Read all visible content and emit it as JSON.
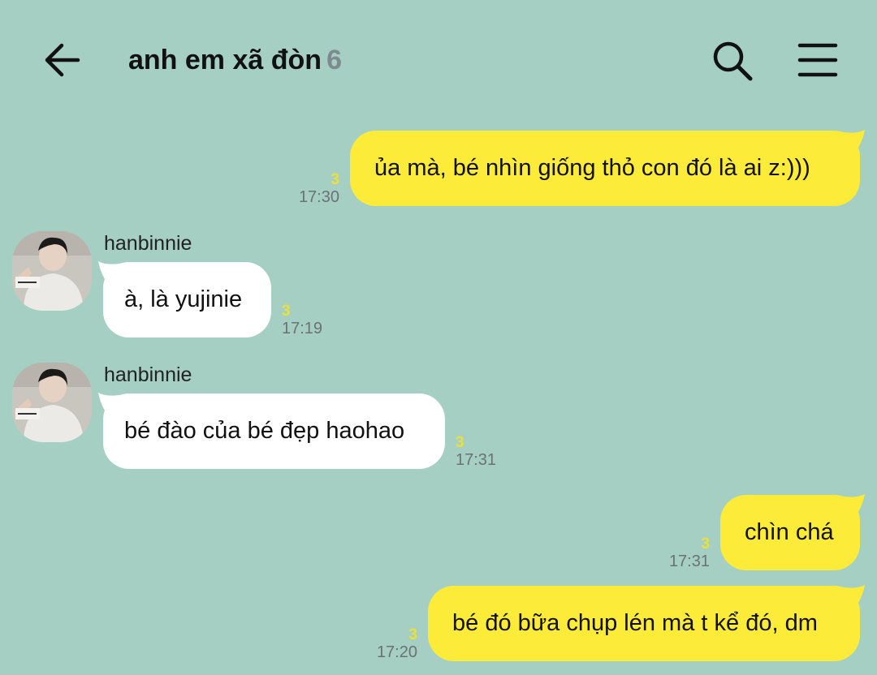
{
  "header": {
    "back_icon": "arrow-left-icon",
    "title": "anh em xã đòn",
    "member_count": "6",
    "search_icon": "search-icon",
    "menu_icon": "hamburger-menu-icon"
  },
  "colors": {
    "background": "#a5cfc2",
    "outgoing_bubble": "#fdeb3a",
    "incoming_bubble": "#ffffff",
    "unread": "#e9e040",
    "time": "#6b7276"
  },
  "messages": [
    {
      "direction": "out",
      "text": "ủa mà, bé nhìn giống thỏ con đó là ai z:)))",
      "unread": "3",
      "time": "17:30"
    },
    {
      "direction": "in",
      "sender": "hanbinnie",
      "text": "à, là yujinie",
      "unread": "3",
      "time": "17:19"
    },
    {
      "direction": "in",
      "sender": "hanbinnie",
      "text": "bé đào của bé đẹp haohao",
      "unread": "3",
      "time": "17:31"
    },
    {
      "direction": "out",
      "text": "chìn chá",
      "unread": "3",
      "time": "17:31"
    },
    {
      "direction": "out",
      "text": "bé đó bữa chụp lén mà t kể đó, dm",
      "unread": "3",
      "time": "17:20"
    }
  ]
}
